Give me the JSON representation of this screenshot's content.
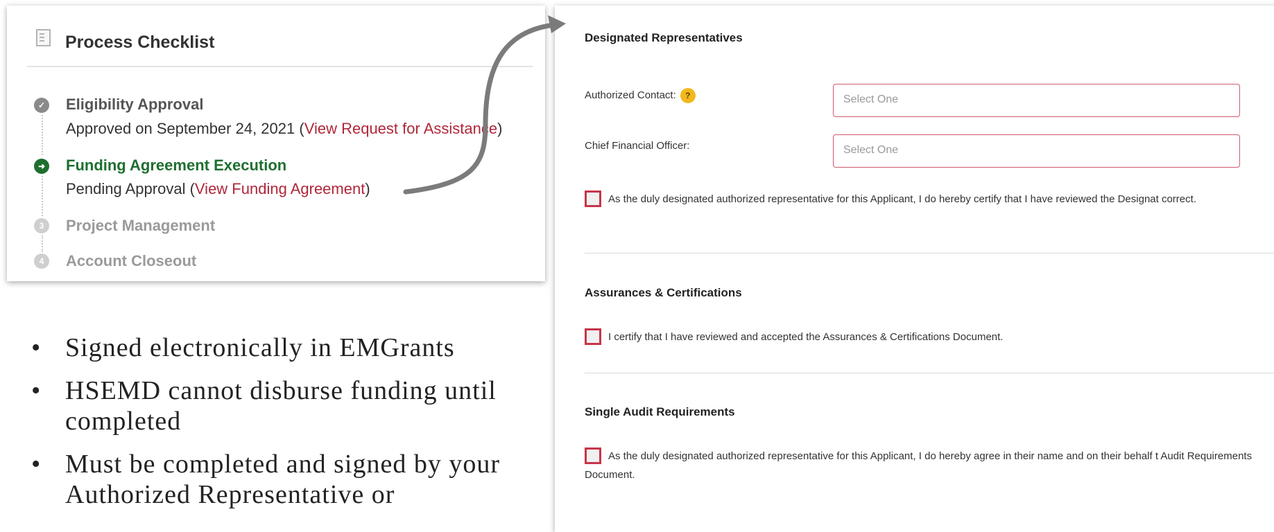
{
  "checklist": {
    "title": "Process Checklist",
    "icon": "document-icon",
    "steps": [
      {
        "title": "Eligibility Approval",
        "status": "done",
        "icon": "check-circle-icon",
        "sub_prefix": "Approved on September 24, 2021 (",
        "sub_link": "View Request for Assistance",
        "sub_suffix": ")"
      },
      {
        "title": "Funding Agreement Execution",
        "status": "current",
        "icon": "arrow-right-circle-icon",
        "sub_prefix": "Pending Approval (",
        "sub_link": "View Funding Agreement",
        "sub_suffix": ")"
      },
      {
        "title": "Project Management",
        "status": "future",
        "icon": "step-3-icon",
        "number": "3"
      },
      {
        "title": "Account Closeout",
        "status": "future",
        "icon": "step-4-icon",
        "number": "4"
      }
    ]
  },
  "bullets": [
    "Signed electronically in EMGrants",
    "HSEMD cannot disburse funding until completed",
    "Must be completed and signed by your Authorized Representative or"
  ],
  "form": {
    "designated": {
      "title": "Designated Representatives",
      "authorized_contact_label": "Authorized Contact:",
      "help_icon_text": "?",
      "authorized_contact_placeholder": "Select One",
      "cfo_label": "Chief Financial Officer:",
      "cfo_placeholder": "Select One",
      "certify_text": "As the duly designated authorized representative for this Applicant, I do hereby certify that I have reviewed the Designat correct."
    },
    "assurances": {
      "title": "Assurances & Certifications",
      "certify_text": "I certify that I have reviewed and accepted the Assurances & Certifications Document."
    },
    "audit": {
      "title": "Single Audit Requirements",
      "certify_text": "As the duly designated authorized representative for this Applicant, I do hereby agree in their name and on their behalf t Audit Requirements Document."
    }
  },
  "colors": {
    "accent_green": "#1e6f2f",
    "link_red": "#b0273a",
    "checkbox_red": "#c8344a",
    "help_yellow": "#f2b81c"
  }
}
